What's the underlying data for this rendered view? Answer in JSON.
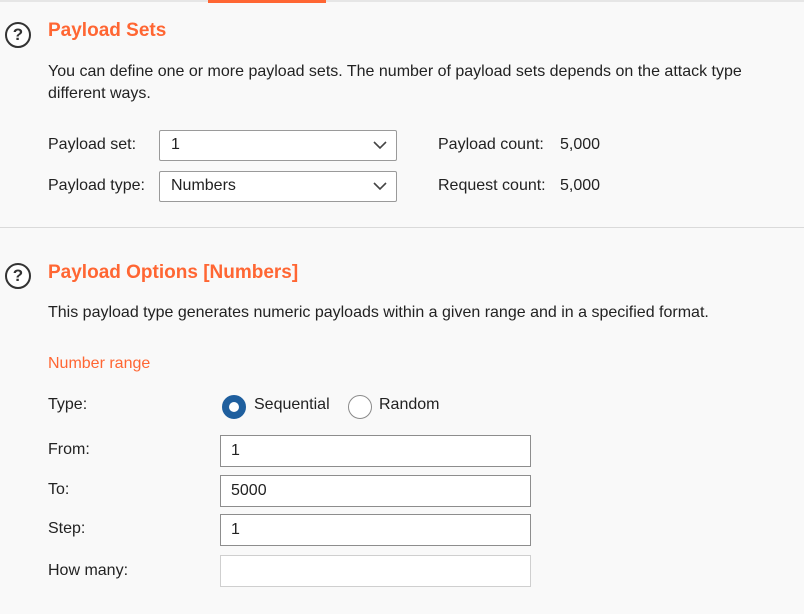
{
  "colors": {
    "accent": "#ff6633",
    "radio_selected": "#1f5f9e"
  },
  "icons": {
    "help": "help-circle-icon",
    "dropdown": "chevron-down-icon"
  },
  "payload_sets": {
    "help_glyph": "?",
    "title": "Payload Sets",
    "description_line1": "You can define one or more payload sets. The number of payload sets depends on the attack type",
    "description_line2": "different ways.",
    "payload_set_label": "Payload set:",
    "payload_set_value": "1",
    "payload_type_label": "Payload type:",
    "payload_type_value": "Numbers",
    "payload_count_label": "Payload count:",
    "payload_count_value": "5,000",
    "request_count_label": "Request count:",
    "request_count_value": "5,000"
  },
  "payload_options": {
    "help_glyph": "?",
    "title": "Payload Options [Numbers]",
    "description": "This payload type generates numeric payloads within a given range and in a specified format.",
    "number_range_heading": "Number range",
    "type_label": "Type:",
    "type_options": [
      {
        "label": "Sequential",
        "selected": true
      },
      {
        "label": "Random",
        "selected": false
      }
    ],
    "from_label": "From:",
    "from_value": "1",
    "to_label": "To:",
    "to_value": "5000",
    "step_label": "Step:",
    "step_value": "1",
    "how_many_label": "How many:",
    "how_many_value": ""
  }
}
